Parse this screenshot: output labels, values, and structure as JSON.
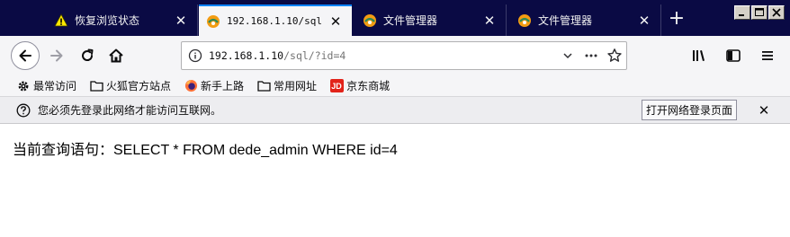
{
  "tabs": [
    {
      "title": "恢复浏览状态",
      "icon": "warning-icon",
      "active": false
    },
    {
      "title": "192.168.1.10/sql",
      "icon": "phpstudy-icon",
      "active": true
    },
    {
      "title": "文件管理器",
      "icon": "phpstudy-icon",
      "active": false
    },
    {
      "title": "文件管理器",
      "icon": "phpstudy-icon",
      "active": false
    }
  ],
  "newtab_label": "+",
  "navbar": {
    "url_host": "192.168.1.10",
    "url_path": "/sql/?id=4"
  },
  "bookmarks": [
    {
      "label": "最常访问",
      "icon": "gear-icon"
    },
    {
      "label": "火狐官方站点",
      "icon": "folder-icon"
    },
    {
      "label": "新手上路",
      "icon": "firefox-icon"
    },
    {
      "label": "常用网址",
      "icon": "folder-icon"
    },
    {
      "label": "京东商城",
      "icon": "jd-icon",
      "badge": "JD"
    }
  ],
  "notification": {
    "message": "您必须先登录此网络才能访问互联网。",
    "button_label": "打开网络登录页面"
  },
  "content": {
    "query_text": "当前查询语句：SELECT * FROM dede_admin WHERE id=4"
  },
  "colors": {
    "tabstrip_bg": "#0a0a44",
    "accent": "#0a84ff",
    "jd_red": "#e2231a",
    "warning_yellow": "#ffe900"
  }
}
